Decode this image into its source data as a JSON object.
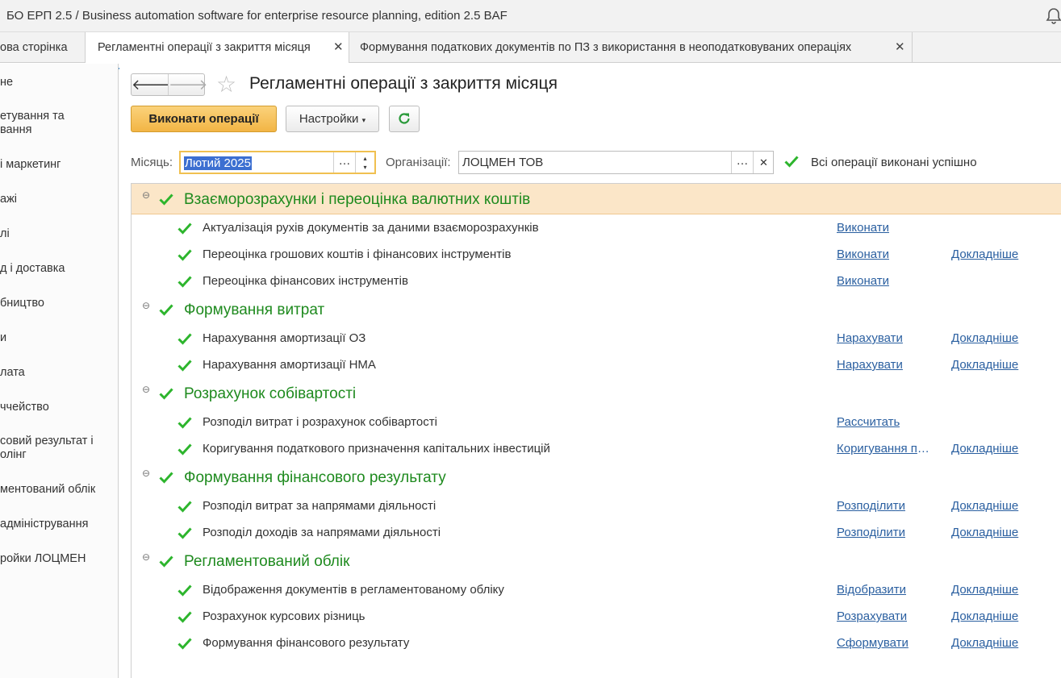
{
  "window": {
    "title": "БО ЕРП 2.5 / Business automation software for enterprise resource planning, edition 2.5 BAF"
  },
  "tabs": [
    {
      "label": "ова сторінка"
    },
    {
      "label": "Регламентні операції з закриття місяця"
    },
    {
      "label": "Формування податкових документів по ПЗ з використання в неоподатковуваних операціях"
    }
  ],
  "sidebar": {
    "items": [
      {
        "label": "не"
      },
      {
        "label": "етування та\nвання"
      },
      {
        "label": "і маркетинг"
      },
      {
        "label": "ажі"
      },
      {
        "label": "лі"
      },
      {
        "label": "д і доставка"
      },
      {
        "label": "бництво"
      },
      {
        "label": "и"
      },
      {
        "label": "лата"
      },
      {
        "label": "ччейство"
      },
      {
        "label": "совий результат і\nолінг"
      },
      {
        "label": "ментований облік"
      },
      {
        "label": "адміністрування"
      },
      {
        "label": "ройки ЛОЦМЕН"
      }
    ]
  },
  "page": {
    "title": "Регламентні операції з закриття місяця"
  },
  "toolbar": {
    "run_label": "Виконати операції",
    "settings_label": "Настройки"
  },
  "filters": {
    "month_label": "Місяць:",
    "month_value": "Лютий 2025",
    "org_label": "Організації:",
    "org_value": "ЛОЦМЕН ТОВ",
    "status_text": "Всі операції виконані успішно"
  },
  "groups": [
    {
      "title": "Взаєморозрахунки і переоцінка валютних коштів",
      "ops": [
        {
          "text": "Актуалізація рухів документів за даними взаєморозрахунків",
          "action": "Виконати",
          "more": ""
        },
        {
          "text": "Переоцінка грошових коштів і фінансових інструментів",
          "action": "Виконати",
          "more": "Докладніше"
        },
        {
          "text": "Переоцінка фінансових інструментів",
          "action": "Виконати",
          "more": ""
        }
      ]
    },
    {
      "title": "Формування витрат",
      "ops": [
        {
          "text": "Нарахування амортизації ОЗ",
          "action": "Нарахувати",
          "more": "Докладніше"
        },
        {
          "text": "Нарахування амортизації НМА",
          "action": "Нарахувати",
          "more": "Докладніше"
        }
      ]
    },
    {
      "title": "Розрахунок собівартості",
      "ops": [
        {
          "text": "Розподіл витрат і розрахунок собівартості",
          "action": "Рассчитать",
          "more": ""
        },
        {
          "text": "Коригування податкового призначення капітальних інвестицій",
          "action": "Коригування податкового",
          "more": "Докладніше"
        }
      ]
    },
    {
      "title": "Формування фінансового результату",
      "ops": [
        {
          "text": "Розподіл витрат за напрямами діяльності",
          "action": "Розподілити",
          "more": "Докладніше"
        },
        {
          "text": "Розподіл доходів за напрямами діяльності",
          "action": "Розподілити",
          "more": "Докладніше"
        }
      ]
    },
    {
      "title": "Регламентований облік",
      "ops": [
        {
          "text": "Відображення документів в регламентованому обліку",
          "action": "Відобразити",
          "more": "Докладніше"
        },
        {
          "text": "Розрахунок курсових різниць",
          "action": "Розрахувати",
          "more": "Докладніше"
        },
        {
          "text": "Формування фінансового результату",
          "action": "Сформувати",
          "more": "Докладніше"
        }
      ]
    }
  ],
  "colors": {
    "accent_green": "#1e8a1e",
    "check_green": "#2db52d",
    "link_blue": "#2a5fa0",
    "primary_button": "#f2b545",
    "highlight_row": "#fbe6c8"
  }
}
